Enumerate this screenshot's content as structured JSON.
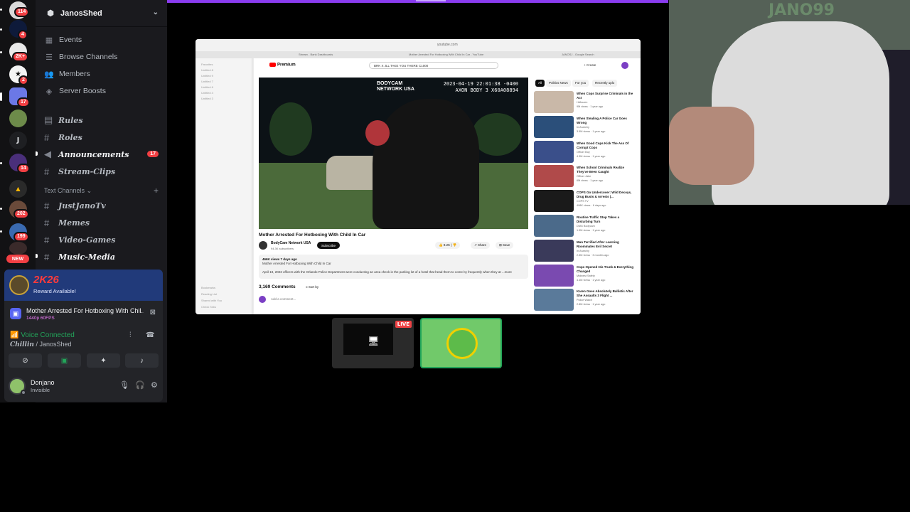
{
  "server": {
    "name": "JanosShed",
    "menu": [
      "Events",
      "Browse Channels",
      "Members",
      "Server Boosts"
    ]
  },
  "rail": {
    "badges": [
      "114",
      "4",
      "2K+",
      "2",
      "17",
      "14",
      "202",
      "199"
    ],
    "letter": "J",
    "new_label": "NEW"
  },
  "channels": {
    "top": [
      {
        "name": "Rules"
      },
      {
        "name": "Roles"
      },
      {
        "name": "Announcements",
        "mentions": "17"
      },
      {
        "name": "Stream-Clips"
      }
    ],
    "category": "Text Channels",
    "text": [
      "JustJanoTv",
      "Memes",
      "Video-Games",
      "Music-Media"
    ]
  },
  "promo": {
    "logo_main": "2K26",
    "reward": "Reward Available!"
  },
  "now_playing": {
    "title": "Mother Arrested For Hotboxing With Chil...",
    "quality": "1440p 60FPS"
  },
  "voice": {
    "status": "Voice Connected",
    "channel_prefix": "Chillin",
    "channel_suffix": " / JanosShed"
  },
  "user": {
    "name": "Donjano",
    "status": "Invisible"
  },
  "browser": {
    "url": "youtube.com",
    "tabs": [
      "Stream - Bank Dashboards",
      "Mother Arrested For Hotboxing With Child In Car - YouTube",
      "JANOSJ - Google Search"
    ],
    "sidebar": [
      "Favorites",
      "Untitled 8",
      "Untitled 9",
      "Untitled 7",
      "Untitled 6",
      "Untitled 4",
      "Untitled 3",
      "Bookmarks",
      "Reading List",
      "Shared with You",
      "Check Tabs"
    ]
  },
  "youtube": {
    "logo": "Premium",
    "search": "BRK X JLL TAKE YOU THERE C1000",
    "create": "+ Create",
    "video": {
      "brand": "BODYCAM\nNETWORK USA",
      "stamp": "2023-04-19 22:01:38 -0400\nAXON BODY 3 X60A08894"
    },
    "title": "Mother Arrested For Hotboxing With Child In Car",
    "channel": "BodyCam Network USA",
    "subs": "94.3K subscribers",
    "subscribe": "Subscribe",
    "likes": "8.2K",
    "share": "Share",
    "save": "Save",
    "views": "466K views  7 days ago",
    "desc_title": "Mother Arrested For Hotboxing With Child In Car",
    "desc_text": "April 19, 2023 officers with the Orlando Police Department were conducting an area check in the parking lot of a hotel that head them to come by frequently when they at ...more",
    "comments": "3,169 Comments",
    "sort": "Sort by",
    "add_comment": "Add a comment...",
    "chips": [
      "All",
      "Politics News",
      "For you",
      "Recently uplo"
    ],
    "recs": [
      {
        "title": "When Cops Surprise Criminals in the Act",
        "channel": "Hdfrozen",
        "views": "9M views · 1 year ago",
        "color": "#c9b8a8"
      },
      {
        "title": "When Stealing A Police Car Goes Wrong",
        "channel": "In Anarchy",
        "views": "3.5M views · 1 year ago",
        "color": "#2b4f7a"
      },
      {
        "title": "When Good Cops Kick The Ass Of Corrupt Cops",
        "channel": "Officer Boy",
        "views": "4.3M views · 1 year ago",
        "color": "#3a4f8a"
      },
      {
        "title": "When School Criminals Realize They've Been Caught",
        "channel": "Officer Jake",
        "views": "6M views · 1 year ago",
        "color": "#b04a4a"
      },
      {
        "title": "COPS Go Undercover: Wild Decoys, Drug Busts & Arrests |...",
        "channel": "COPS TV",
        "views": "498K views · 6 days ago",
        "color": "#1a1a1a"
      },
      {
        "title": "Routine Traffic Stop Takes a Disturbing Turn",
        "channel": "DMG Bodycam",
        "views": "1.9M views · 1 year ago",
        "color": "#4b6a8a"
      },
      {
        "title": "Man Terrified After Learning Roommates Evil Secret",
        "channel": "In Anarchy",
        "views": "2.5M views · 3 months ago",
        "color": "#3a3a5a"
      },
      {
        "title": "Cops Opened His Trunk & Everything Changed",
        "channel": "Midwest Safety",
        "views": "4.4M views · 1 year ago",
        "color": "#7a4ab0"
      },
      {
        "title": "Karen Goes Absolutely Ballistic After She Assaults 3 Flight ...",
        "channel": "Police Watch",
        "views": "2.8M views · 1 year ago",
        "color": "#5a7a9a"
      }
    ]
  },
  "tiles": {
    "live": "LIVE"
  },
  "webcam": {
    "tag": "JANO99"
  }
}
